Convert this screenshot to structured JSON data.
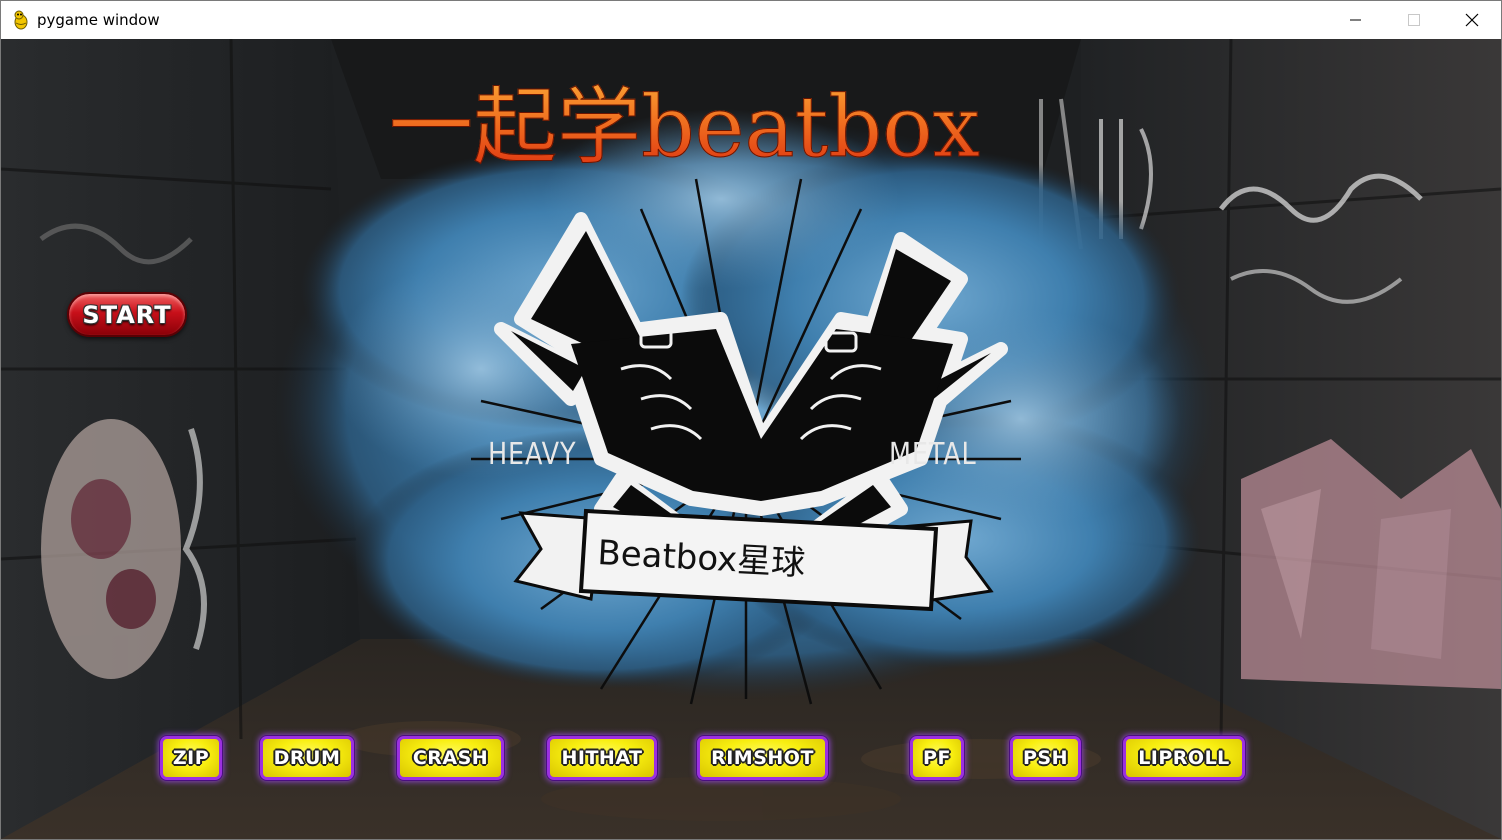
{
  "window": {
    "title": "pygame window",
    "icon": "pygame-snake-icon",
    "controls": {
      "minimize_icon": "minimize-icon",
      "maximize_icon": "maximize-icon",
      "close_icon": "close-icon"
    }
  },
  "game": {
    "title": "一起学beatbox",
    "title_colors": [
      "#ffb13a",
      "#f07020",
      "#d8200c"
    ],
    "start_button": {
      "label": "START",
      "color": "#c8101a"
    },
    "logo": {
      "left_word": "HEAVY",
      "right_word": "METAL",
      "banner_text": "Beatbox星球",
      "icon": "rock-hands-icon",
      "backdrop": "blue-smoke-cloud"
    },
    "background": "graffiti-tunnel",
    "sound_buttons": [
      {
        "id": "zip",
        "label": "ZIP"
      },
      {
        "id": "drum",
        "label": "DRUM"
      },
      {
        "id": "crash",
        "label": "CRASH"
      },
      {
        "id": "hithat",
        "label": "HITHAT"
      },
      {
        "id": "rimshot",
        "label": "RIMSHOT"
      },
      {
        "id": "pf",
        "label": "PF"
      },
      {
        "id": "psh",
        "label": "PSH"
      },
      {
        "id": "liproll",
        "label": "LIPROLL"
      }
    ],
    "sound_button_colors": {
      "fill": "#f8ee10",
      "border": "#9b30e0"
    }
  }
}
